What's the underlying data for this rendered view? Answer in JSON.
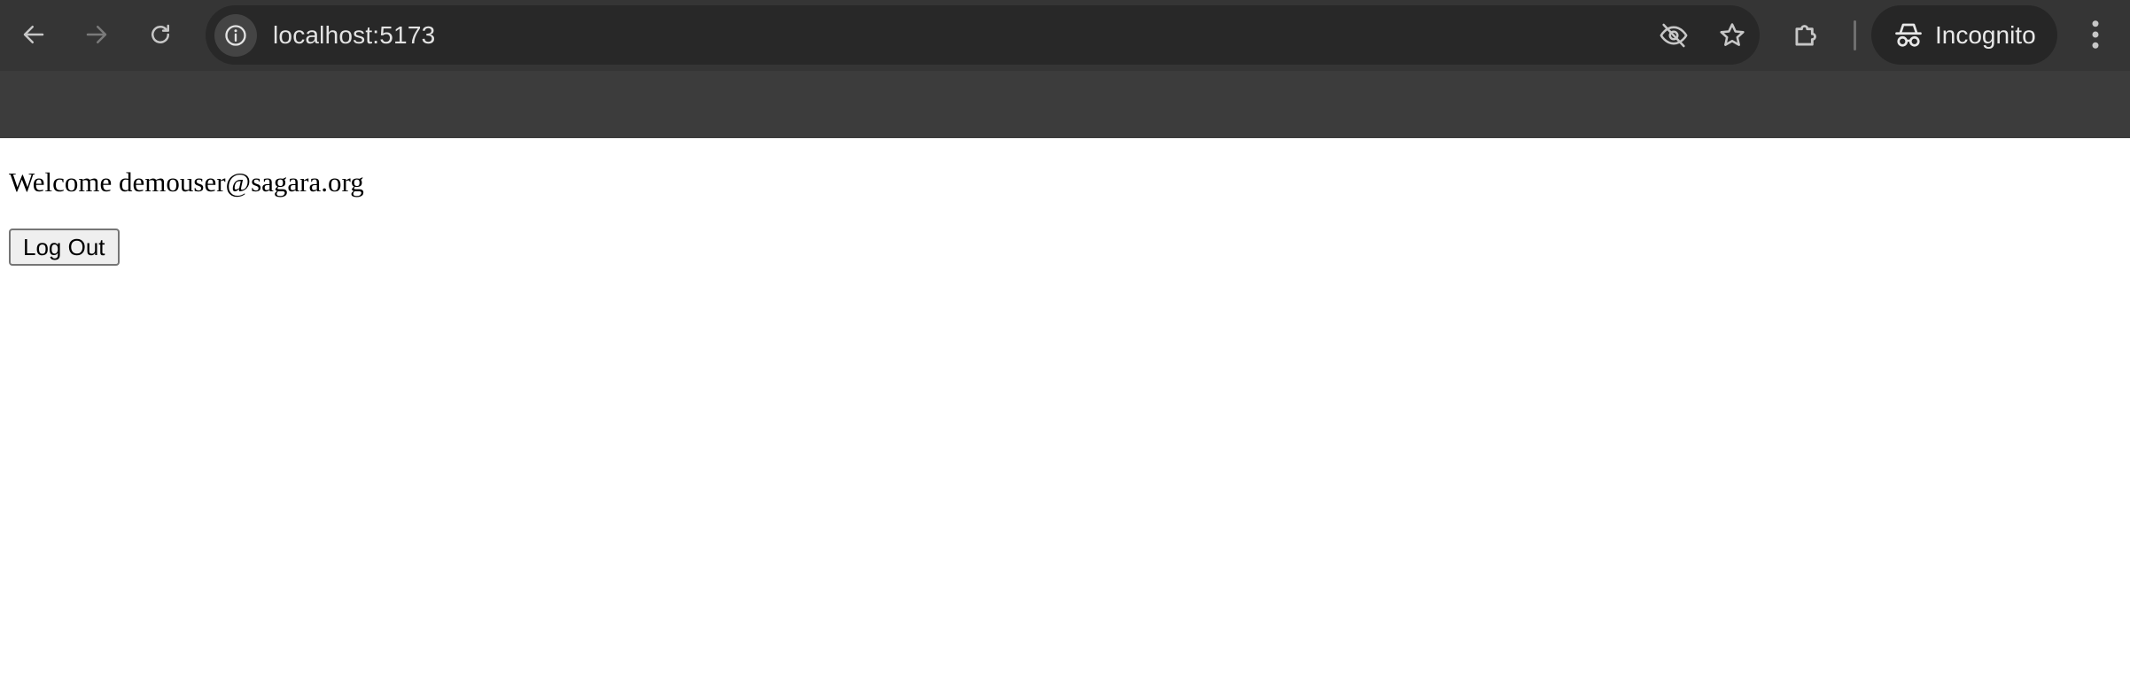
{
  "browser": {
    "url": "localhost:5173",
    "incognito_label": "Incognito"
  },
  "page": {
    "welcome_text": "Welcome demouser@sagara.org",
    "logout_label": "Log Out"
  },
  "colors": {
    "chrome_bg": "#3c3c3c",
    "toolbar_bg": "#353535",
    "omnibox_bg": "#282828",
    "icon_active": "#c7c7c7",
    "icon_disabled": "#7a7a7a"
  }
}
